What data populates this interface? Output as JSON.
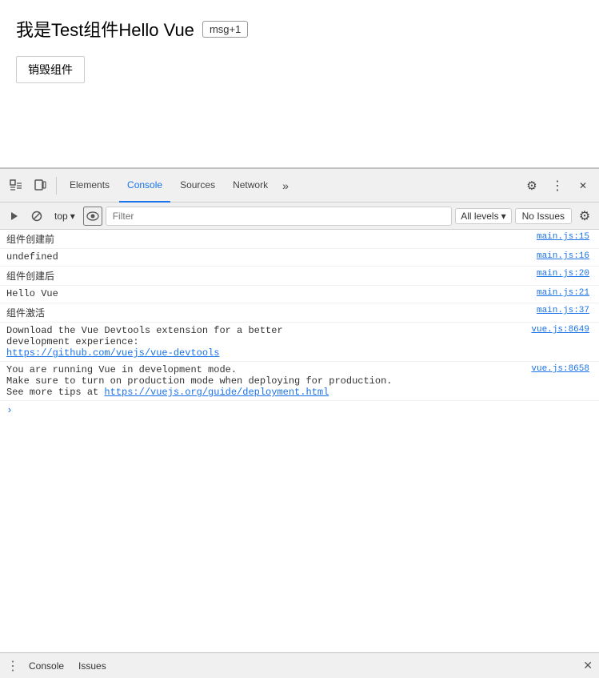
{
  "page": {
    "title_text": "我是Test组件Hello Vue",
    "msg_badge": "msg+1",
    "destroy_btn": "销毁组件"
  },
  "devtools": {
    "tabs": [
      {
        "label": "Elements",
        "active": false
      },
      {
        "label": "Console",
        "active": true
      },
      {
        "label": "Sources",
        "active": false
      },
      {
        "label": "Network",
        "active": false
      }
    ],
    "more_btn": "»",
    "top_selector": "top",
    "filter_placeholder": "Filter",
    "levels_label": "All levels",
    "no_issues": "No Issues"
  },
  "console": {
    "rows": [
      {
        "text": "组件创建前",
        "link": "main.js:15"
      },
      {
        "text": "undefined",
        "link": "main.js:16"
      },
      {
        "text": "组件创建后",
        "link": "main.js:20"
      },
      {
        "text": "Hello Vue",
        "link": "main.js:21"
      },
      {
        "text": "组件激活",
        "link": "main.js:37"
      }
    ],
    "devtools_msg_line1": "Download the Vue Devtools extension for a better",
    "devtools_msg_line2": "development experience:",
    "devtools_msg_link": "https://github.com/vuejs/vue-devtools",
    "devtools_msg_filelink": "vue.js:8649",
    "prod_msg_line1": "You are running Vue in development mode.",
    "prod_msg_line2": "Make sure to turn on production mode when deploying for production.",
    "prod_msg_line3": "See more tips at ",
    "prod_msg_link": "https://vuejs.org/guide/deployment.html",
    "prod_msg_filelink": "vue.js:8658"
  },
  "statusbar": {
    "console_tab": "Console",
    "issues_tab": "Issues"
  },
  "icons": {
    "inspect": "⬚",
    "device": "⬕",
    "play": "▶",
    "block": "⊘",
    "chevron_down": "▾",
    "eye": "◉",
    "gear": "⚙",
    "more_vert": "⋮",
    "close": "✕"
  }
}
